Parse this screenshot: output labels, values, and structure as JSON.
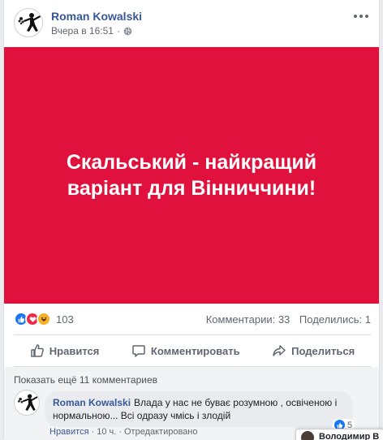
{
  "post": {
    "author": "Roman Kowalski",
    "timestamp": "Вчера в 16:51",
    "privacy_icon": "globe-icon",
    "image_text": "Скальський - найкращий варіант для Вінниччини!",
    "image_bg": "#e0113c"
  },
  "stats": {
    "reactions": [
      "like",
      "love",
      "haha"
    ],
    "reactions_count": "103",
    "comments": "Комментарии: 33",
    "shares": "Поделились: 1"
  },
  "actions": {
    "like": "Нравится",
    "comment": "Комментировать",
    "share": "Поделиться"
  },
  "comments": {
    "show_more": "Показать ещё 11 комментариев",
    "items": [
      {
        "author": "Roman Kowalski",
        "text": "Влада у нас не буває розумною , освіченою і нормальною... Всі одразу чмісь і злодій",
        "like_label": "Нравится",
        "time": "10 ч.",
        "edited": "Отредактировано",
        "reaction_count": "5"
      }
    ]
  },
  "chat": {
    "name": "Володимир В"
  }
}
